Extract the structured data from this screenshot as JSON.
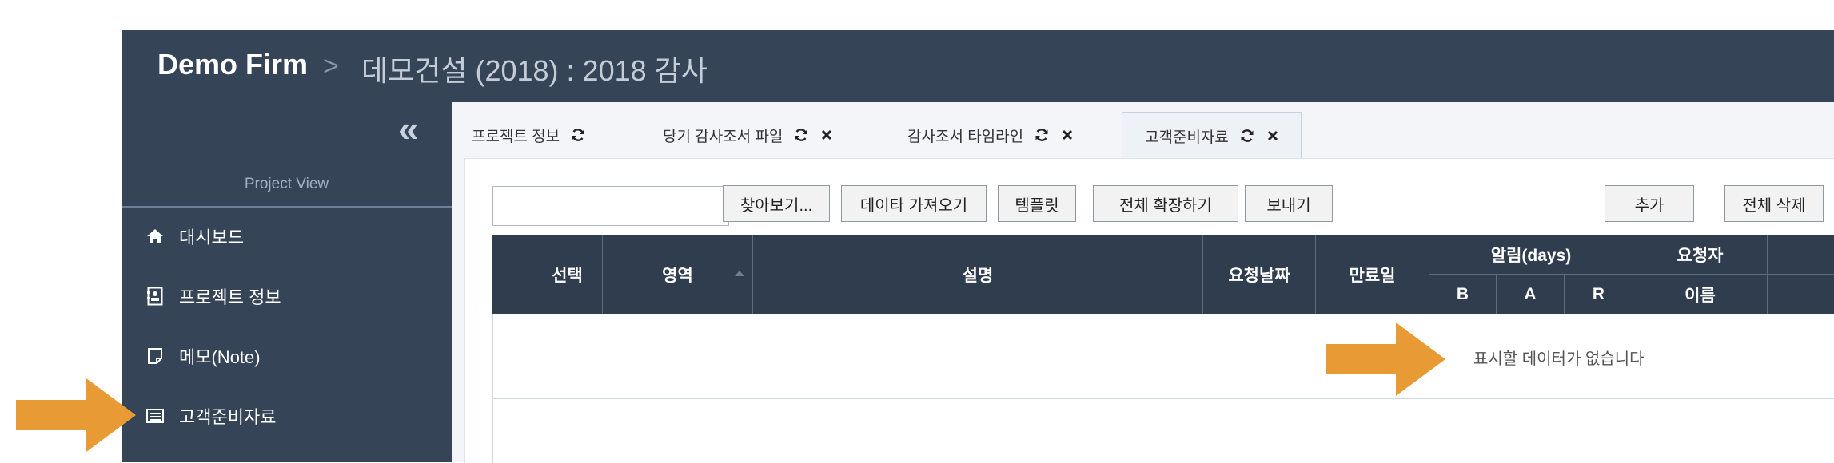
{
  "header": {
    "brand": "Demo Firm",
    "separator": ">",
    "project_title": "데모건설 (2018) : 2018 감사"
  },
  "sidebar": {
    "collapse_label": "«",
    "heading": "Project View",
    "items": [
      {
        "label": "대시보드",
        "icon": "home-icon"
      },
      {
        "label": "프로젝트 정보",
        "icon": "contact-card-icon"
      },
      {
        "label": "메모(Note)",
        "icon": "note-icon"
      },
      {
        "label": "고객준비자료",
        "icon": "list-box-icon"
      }
    ]
  },
  "tabs": [
    {
      "label": "프로젝트 정보",
      "closable": false
    },
    {
      "label": "당기 감사조서 파일",
      "closable": true
    },
    {
      "label": "감사조서 타임라인",
      "closable": true
    },
    {
      "label": "고객준비자료",
      "closable": true,
      "active": true
    }
  ],
  "toolbar": {
    "search_value": "",
    "browse": "찾아보기...",
    "import": "데이타 가져오기",
    "template": "템플릿",
    "expand_all": "전체 확장하기",
    "send": "보내기",
    "add": "추가",
    "delete_all": "전체 삭제"
  },
  "grid": {
    "columns": {
      "select": "선택",
      "area": "영역",
      "description": "설명",
      "request_date": "요청날짜",
      "due_date": "만료일",
      "alert_days": "알림(days)",
      "requester": "요청자"
    },
    "alert_sub": [
      "B",
      "A",
      "R"
    ],
    "requester_sub": "이름",
    "empty_message": "표시할 데이터가 없습니다"
  },
  "colors": {
    "sidebar": "#354456",
    "grid_header": "#2f3d4f",
    "callout_arrow": "#e89b34"
  }
}
